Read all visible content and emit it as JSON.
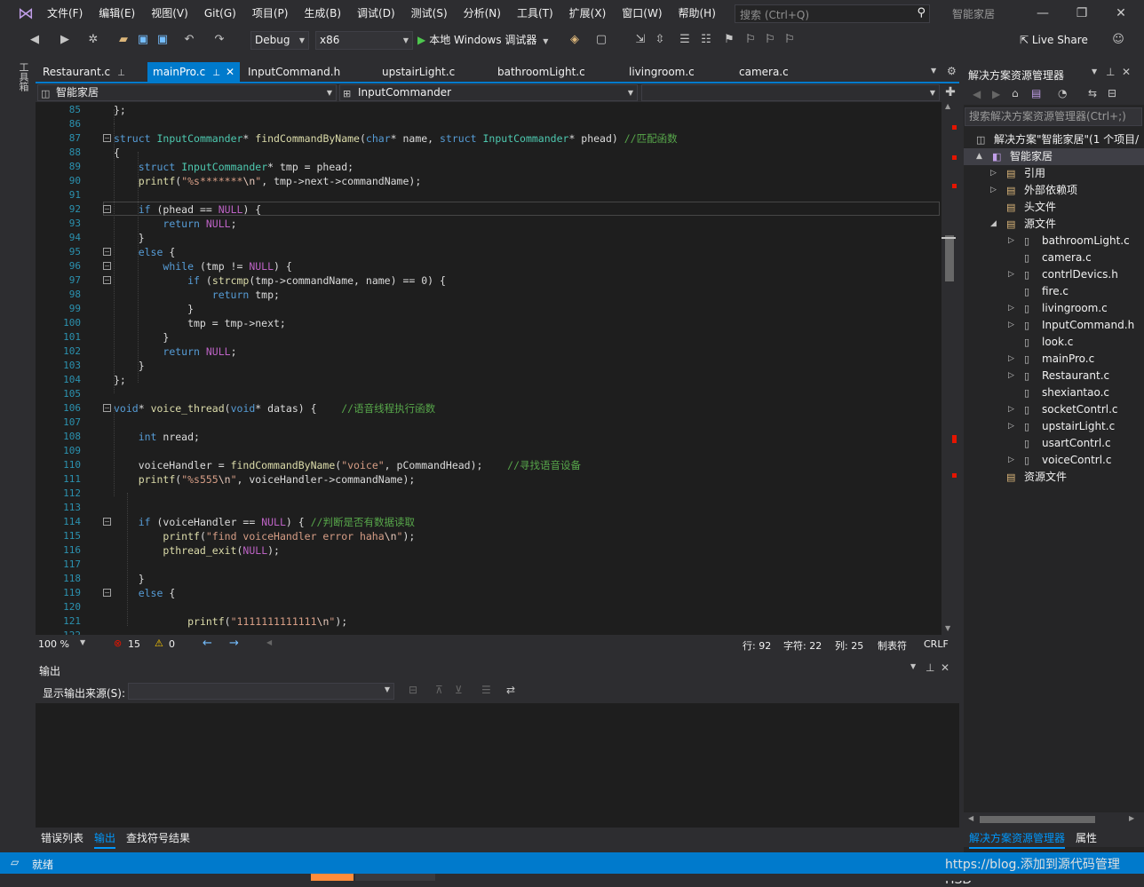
{
  "title_bar": {
    "menu": [
      "文件(F)",
      "编辑(E)",
      "视图(V)",
      "Git(G)",
      "项目(P)",
      "生成(B)",
      "调试(D)",
      "测试(S)",
      "分析(N)",
      "工具(T)",
      "扩展(X)",
      "窗口(W)",
      "帮助(H)"
    ],
    "search_placeholder": "搜索 (Ctrl+Q)",
    "solution_name": "智能家居"
  },
  "toolbar": {
    "config": "Debug",
    "platform": "x86",
    "run_label": "本地 Windows 调试器",
    "live_share": "Live Share"
  },
  "left_strip": {
    "toolbox": "工具箱"
  },
  "tabs": [
    {
      "label": "Restaurant.c",
      "active": false
    },
    {
      "label": "mainPro.c",
      "active": true
    },
    {
      "label": "InputCommand.h",
      "active": false
    },
    {
      "label": "upstairLight.c",
      "active": false
    },
    {
      "label": "bathroomLight.c",
      "active": false
    },
    {
      "label": "livingroom.c",
      "active": false
    },
    {
      "label": "camera.c",
      "active": false
    }
  ],
  "nav": {
    "project": "智能家居",
    "scope": "InputCommander"
  },
  "code_lines": [
    {
      "n": "85",
      "t": "};"
    },
    {
      "n": "86",
      "t": ""
    },
    {
      "n": "87",
      "t": "struct InputCommander* findCommandByName(char* name, struct InputCommander* phead) //匹配函数"
    },
    {
      "n": "88",
      "t": "{"
    },
    {
      "n": "89",
      "t": "    struct InputCommander* tmp = phead;"
    },
    {
      "n": "90",
      "t": "    printf(\"%s*******\\n\", tmp->next->commandName);"
    },
    {
      "n": "91",
      "t": ""
    },
    {
      "n": "92",
      "t": "    if (phead == NULL) {"
    },
    {
      "n": "93",
      "t": "        return NULL;"
    },
    {
      "n": "94",
      "t": "    }"
    },
    {
      "n": "95",
      "t": "    else {"
    },
    {
      "n": "96",
      "t": "        while (tmp != NULL) {"
    },
    {
      "n": "97",
      "t": "            if (strcmp(tmp->commandName, name) == 0) {"
    },
    {
      "n": "98",
      "t": "                return tmp;"
    },
    {
      "n": "99",
      "t": "            }"
    },
    {
      "n": "100",
      "t": "            tmp = tmp->next;"
    },
    {
      "n": "101",
      "t": "        }"
    },
    {
      "n": "102",
      "t": "        return NULL;"
    },
    {
      "n": "103",
      "t": "    }"
    },
    {
      "n": "104",
      "t": "};"
    },
    {
      "n": "105",
      "t": ""
    },
    {
      "n": "106",
      "t": "void* voice_thread(void* datas) {    //语音线程执行函数"
    },
    {
      "n": "107",
      "t": ""
    },
    {
      "n": "108",
      "t": "    int nread;"
    },
    {
      "n": "109",
      "t": ""
    },
    {
      "n": "110",
      "t": "    voiceHandler = findCommandByName(\"voice\", pCommandHead);    //寻找语音设备"
    },
    {
      "n": "111",
      "t": "    printf(\"%s555\\n\", voiceHandler->commandName);"
    },
    {
      "n": "112",
      "t": ""
    },
    {
      "n": "113",
      "t": ""
    },
    {
      "n": "114",
      "t": "    if (voiceHandler == NULL) { //判断是否有数据读取"
    },
    {
      "n": "115",
      "t": "        printf(\"find voiceHandler error haha\\n\");"
    },
    {
      "n": "116",
      "t": "        pthread_exit(NULL);"
    },
    {
      "n": "117",
      "t": ""
    },
    {
      "n": "118",
      "t": "    }"
    },
    {
      "n": "119",
      "t": "    else {"
    },
    {
      "n": "120",
      "t": ""
    },
    {
      "n": "121",
      "t": "            printf(\"1111111111111\\n\");"
    },
    {
      "n": "122",
      "t": ""
    }
  ],
  "editor_status": {
    "zoom": "100 %",
    "errors": "15",
    "warnings": "0",
    "line": "行: 92",
    "char": "字符: 22",
    "col": "列: 25",
    "tabs_mode": "制表符",
    "eol": "CRLF"
  },
  "output": {
    "title": "输出",
    "source_label": "显示输出来源(S):",
    "source_value": ""
  },
  "bottom_tabs": [
    "错误列表",
    "输出",
    "查找符号结果"
  ],
  "solution_explorer": {
    "title": "解决方案资源管理器",
    "search_placeholder": "搜索解决方案资源管理器(Ctrl+;)",
    "tree": [
      {
        "label": "解决方案\"智能家居\"(1 个项目/",
        "level": 0,
        "exp": ""
      },
      {
        "label": "智能家居",
        "level": 1,
        "exp": "▲",
        "selected": true
      },
      {
        "label": "引用",
        "level": 2,
        "exp": "▷"
      },
      {
        "label": "外部依赖项",
        "level": 2,
        "exp": "▷"
      },
      {
        "label": "头文件",
        "level": 2,
        "exp": ""
      },
      {
        "label": "源文件",
        "level": 2,
        "exp": "◢"
      },
      {
        "label": "bathroomLight.c",
        "level": 3,
        "exp": "▷"
      },
      {
        "label": "camera.c",
        "level": 3,
        "exp": ""
      },
      {
        "label": "contrlDevics.h",
        "level": 3,
        "exp": "▷"
      },
      {
        "label": "fire.c",
        "level": 3,
        "exp": ""
      },
      {
        "label": "livingroom.c",
        "level": 3,
        "exp": "▷"
      },
      {
        "label": "InputCommand.h",
        "level": 3,
        "exp": "▷"
      },
      {
        "label": "look.c",
        "level": 3,
        "exp": ""
      },
      {
        "label": "mainPro.c",
        "level": 3,
        "exp": "▷"
      },
      {
        "label": "Restaurant.c",
        "level": 3,
        "exp": "▷"
      },
      {
        "label": "shexiantao.c",
        "level": 3,
        "exp": ""
      },
      {
        "label": "socketContrl.c",
        "level": 3,
        "exp": "▷"
      },
      {
        "label": "upstairLight.c",
        "level": 3,
        "exp": "▷"
      },
      {
        "label": "usartContrl.c",
        "level": 3,
        "exp": ""
      },
      {
        "label": "voiceContrl.c",
        "level": 3,
        "exp": "▷"
      },
      {
        "label": "资源文件",
        "level": 2,
        "exp": ""
      }
    ],
    "bottom_tabs": [
      "解决方案资源管理器",
      "属性"
    ]
  },
  "status_bar": {
    "ready": "就绪",
    "right": "https://blog.添加到源代码管理 HSD"
  },
  "colors": {
    "accent": "#007acc",
    "error": "#e51400",
    "warning": "#ffcc00"
  }
}
